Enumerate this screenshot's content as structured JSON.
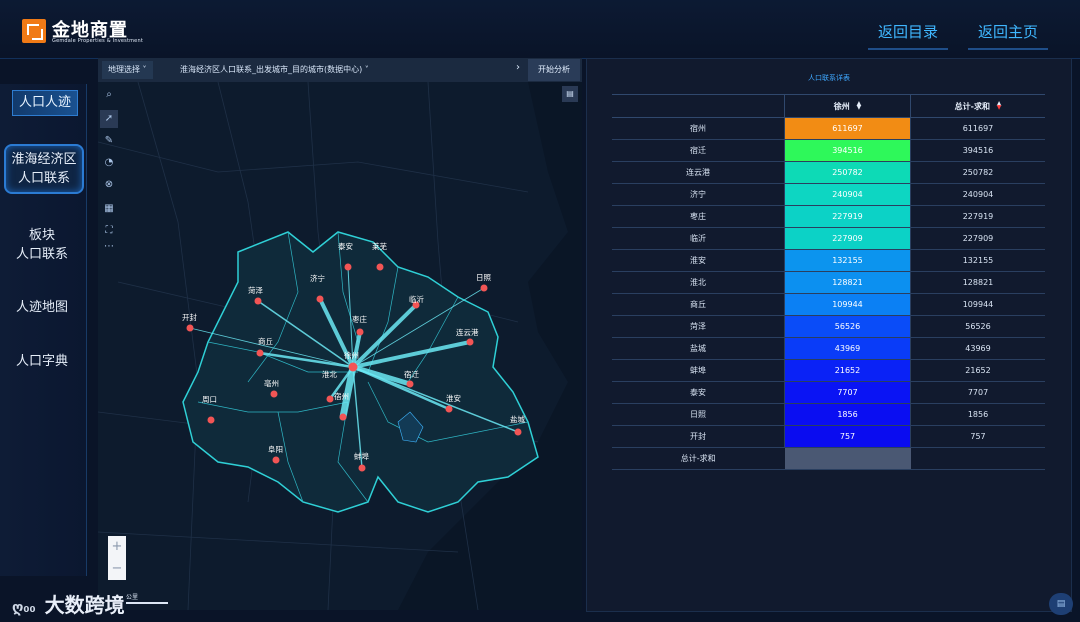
{
  "header": {
    "logo_title": "金地商置",
    "logo_subtitle": "Gemdale Properties & Investment",
    "btn_catalog": "返回目录",
    "btn_home": "返回主页"
  },
  "sidebar": {
    "section_title": "人口人迹",
    "items": [
      {
        "label_line1": "淮海经济区",
        "label_line2": "人口联系",
        "active": true
      },
      {
        "label_line1": "板块",
        "label_line2": "人口联系",
        "active": false
      },
      {
        "label_line1": "人迹地图",
        "label_line2": "",
        "active": false
      },
      {
        "label_line1": "人口字典",
        "label_line2": "",
        "active": false
      }
    ]
  },
  "map": {
    "geo_select": "地理选择",
    "dataset": "淮海经济区人口联系_出发城市_目的城市(数据中心)",
    "analyze_button": "开始分析",
    "scale_label": "公里",
    "zoom_in": "+",
    "zoom_out": "−",
    "origin_city": "徐州",
    "cities": [
      "泰安",
      "莱芜",
      "济宁",
      "日照",
      "菏泽",
      "临沂",
      "枣庄",
      "开封",
      "连云港",
      "商丘",
      "徐州",
      "宿迁",
      "亳州",
      "淮北",
      "周口",
      "宿州",
      "淮安",
      "盐城",
      "阜阳",
      "蚌埠"
    ],
    "icons": {
      "search": "search-icon",
      "pointer": "pointer-icon",
      "draw": "pen-icon",
      "measure": "measure-icon",
      "clear": "clear-icon",
      "basemap": "map-icon",
      "fullscreen": "fullscreen-icon",
      "legend": "legend-icon"
    }
  },
  "table": {
    "title": "人口联系详表",
    "columns": [
      "",
      "徐州",
      "总计-求和"
    ],
    "rows": [
      {
        "city": "宿州",
        "xuzhou": "611697",
        "total": "611697",
        "color": "#f28c14"
      },
      {
        "city": "宿迁",
        "xuzhou": "394516",
        "total": "394516",
        "color": "#2ef85a"
      },
      {
        "city": "连云港",
        "xuzhou": "250782",
        "total": "250782",
        "color": "#0ddab6"
      },
      {
        "city": "济宁",
        "xuzhou": "240904",
        "total": "240904",
        "color": "#0dd6c2"
      },
      {
        "city": "枣庄",
        "xuzhou": "227919",
        "total": "227919",
        "color": "#0cd2c6"
      },
      {
        "city": "临沂",
        "xuzhou": "227909",
        "total": "227909",
        "color": "#0cd2c6"
      },
      {
        "city": "淮安",
        "xuzhou": "132155",
        "total": "132155",
        "color": "#0c94ee"
      },
      {
        "city": "淮北",
        "xuzhou": "128821",
        "total": "128821",
        "color": "#0c90f0"
      },
      {
        "city": "商丘",
        "xuzhou": "109944",
        "total": "109944",
        "color": "#0b80f4"
      },
      {
        "city": "菏泽",
        "xuzhou": "56526",
        "total": "56526",
        "color": "#0a4cf8"
      },
      {
        "city": "盐城",
        "xuzhou": "43969",
        "total": "43969",
        "color": "#0a3cf8"
      },
      {
        "city": "蚌埠",
        "xuzhou": "21652",
        "total": "21652",
        "color": "#0a22f6"
      },
      {
        "city": "泰安",
        "xuzhou": "7707",
        "total": "7707",
        "color": "#0a14f4"
      },
      {
        "city": "日照",
        "xuzhou": "1856",
        "total": "1856",
        "color": "#0a0ef2"
      },
      {
        "city": "开封",
        "xuzhou": "757",
        "total": "757",
        "color": "#0a0cf0"
      }
    ],
    "total_label": "总计-求和",
    "total_xuzhou": "",
    "total_total": ""
  },
  "footer": {
    "brand": "大数跨境",
    "mark": "ღ₀₀"
  },
  "colors": {
    "accent": "#3fb7ff",
    "panel": "#111a2e",
    "flow": "#5fe3f0",
    "marker": "#f25555"
  }
}
